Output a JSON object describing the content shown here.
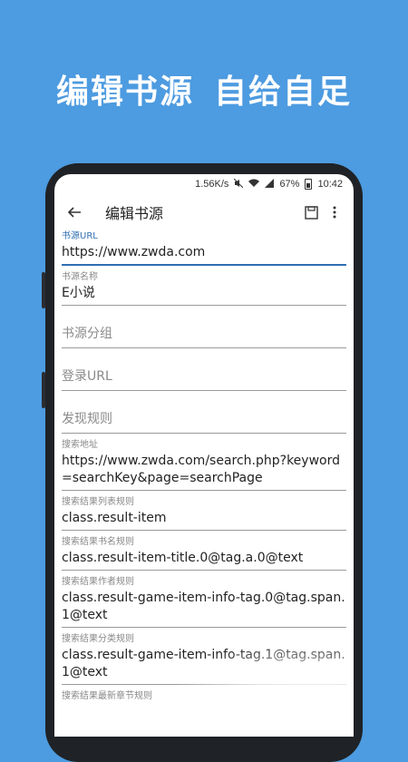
{
  "headline": {
    "part1": "编辑书源",
    "part2": "自给自足"
  },
  "status": {
    "speed": "1.56K/s",
    "battery": "67%",
    "time": "10:42"
  },
  "toolbar": {
    "title": "编辑书源"
  },
  "fields": [
    {
      "label": "书源URL",
      "value": "https://www.zwda.com"
    },
    {
      "label": "书源名称",
      "value": "E小说"
    },
    {
      "placeholder": "书源分组"
    },
    {
      "placeholder": "登录URL"
    },
    {
      "placeholder": "发现规则"
    },
    {
      "label": "搜索地址",
      "value": "https://www.zwda.com/search.php?keyword=searchKey&page=searchPage"
    },
    {
      "label": "搜索结果列表规则",
      "value": "class.result-item"
    },
    {
      "label": "搜索结果书名规则",
      "value": "class.result-item-title.0@tag.a.0@text"
    },
    {
      "label": "搜索结果作者规则",
      "value": "class.result-game-item-info-tag.0@tag.span.1@text"
    },
    {
      "label": "搜索结果分类规则",
      "value": "class.result-game-item-info-tag.1@tag.span.1@text"
    },
    {
      "label": "搜索结果最新章节规则"
    }
  ],
  "colors": {
    "background": "#4d9be0",
    "accent": "#2f6fb3"
  }
}
